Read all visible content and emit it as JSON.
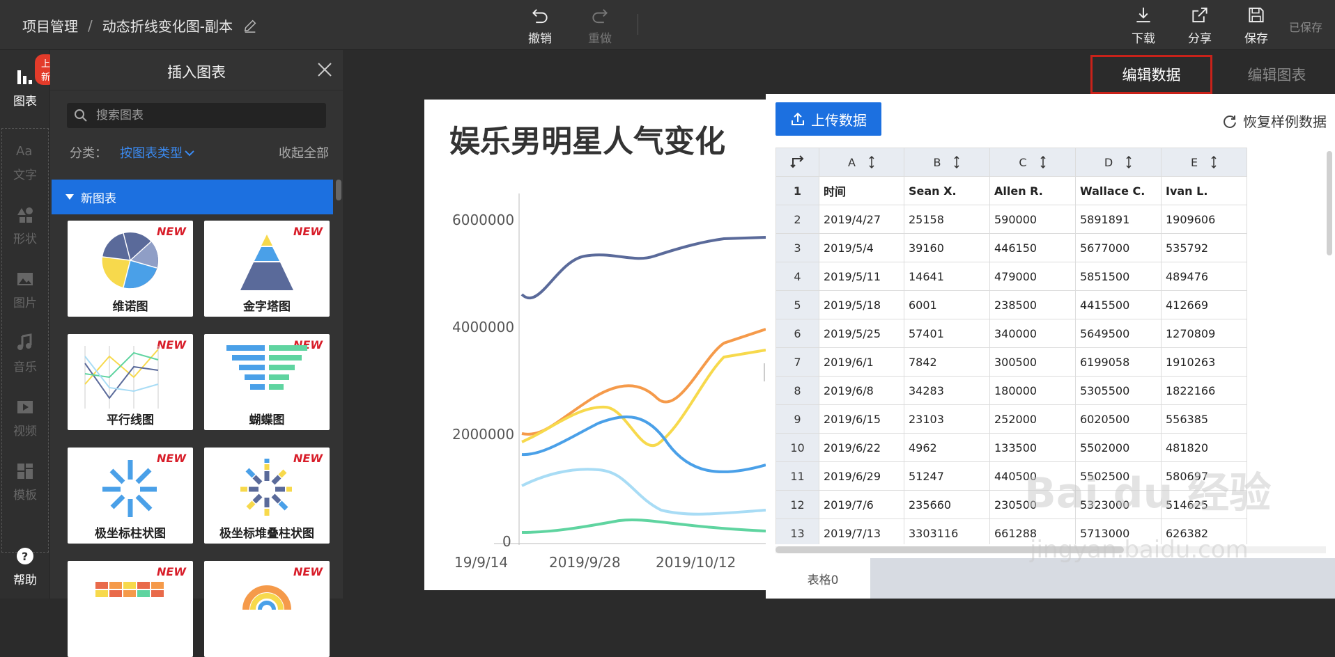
{
  "topbar": {
    "breadcrumb_root": "项目管理",
    "breadcrumb_sep": "/",
    "doc_name": "动态折线变化图-副本",
    "undo": "撤销",
    "redo": "重做",
    "download": "下载",
    "share": "分享",
    "save": "保存",
    "saved_status": "已保存"
  },
  "leftnav": {
    "badge": "上新",
    "items": [
      {
        "label": "图表",
        "icon": "bar-chart-icon"
      },
      {
        "label": "文字",
        "icon": "text-icon"
      },
      {
        "label": "形状",
        "icon": "shapes-icon"
      },
      {
        "label": "图片",
        "icon": "image-icon"
      },
      {
        "label": "音乐",
        "icon": "music-icon"
      },
      {
        "label": "视频",
        "icon": "video-icon"
      },
      {
        "label": "模板",
        "icon": "template-icon"
      }
    ],
    "help": "帮助"
  },
  "insert_panel": {
    "title": "插入图表",
    "search_placeholder": "搜索图表",
    "category_label": "分类：",
    "category_value": "按图表类型",
    "collapse_all": "收起全部",
    "section": "新图表",
    "new_tag": "NEW",
    "cards": [
      "维诺图",
      "金字塔图",
      "平行线图",
      "蝴蝶图",
      "极坐标柱状图",
      "极坐标堆叠柱状图",
      "",
      ""
    ]
  },
  "canvas": {
    "chart_title": "娱乐男明星人气变化",
    "y_ticks": [
      "6000000",
      "4000000",
      "2000000",
      "0"
    ],
    "x_ticks": [
      "19/9/14",
      "2019/9/28",
      "2019/10/12"
    ]
  },
  "tabs": {
    "edit_data": "编辑数据",
    "edit_chart": "编辑图表"
  },
  "data_panel": {
    "upload": "上传数据",
    "restore": "恢复样例数据",
    "columns": [
      "A",
      "B",
      "C",
      "D",
      "E"
    ],
    "rows": [
      [
        "1",
        "时间",
        "Sean X.",
        "Allen R.",
        "Wallace C.",
        "Ivan L."
      ],
      [
        "2",
        "2019/4/27",
        "25158",
        "590000",
        "5891891",
        "1909606"
      ],
      [
        "3",
        "2019/5/4",
        "39160",
        "446150",
        "5677000",
        "535792"
      ],
      [
        "4",
        "2019/5/11",
        "14641",
        "479000",
        "5851500",
        "489476"
      ],
      [
        "5",
        "2019/5/18",
        "6001",
        "238500",
        "4415500",
        "412669"
      ],
      [
        "6",
        "2019/5/25",
        "57401",
        "340000",
        "5649500",
        "1270809"
      ],
      [
        "7",
        "2019/6/1",
        "7842",
        "300500",
        "6199058",
        "1910263"
      ],
      [
        "8",
        "2019/6/8",
        "34283",
        "180000",
        "5305500",
        "1822166"
      ],
      [
        "9",
        "2019/6/15",
        "23103",
        "252000",
        "6020500",
        "556385"
      ],
      [
        "10",
        "2019/6/22",
        "4962",
        "133500",
        "5502000",
        "481820"
      ],
      [
        "11",
        "2019/6/29",
        "51247",
        "440500",
        "5502500",
        "580697"
      ],
      [
        "12",
        "2019/7/6",
        "235660",
        "230500",
        "5323000",
        "514625"
      ],
      [
        "13",
        "2019/7/13",
        "3303116",
        "661288",
        "5713000",
        "626382"
      ]
    ],
    "sheet_tab": "表格0"
  },
  "watermark": {
    "main": "Bai du 经验",
    "sub": "jingyan.baidu.com"
  },
  "colors": {
    "accent": "#1c70e0",
    "highlight_border": "#c9221a",
    "series": [
      "#5a6a9a",
      "#f59a4a",
      "#f7d94c",
      "#4aa0e8",
      "#a8dcf5",
      "#5fd4a0"
    ]
  }
}
